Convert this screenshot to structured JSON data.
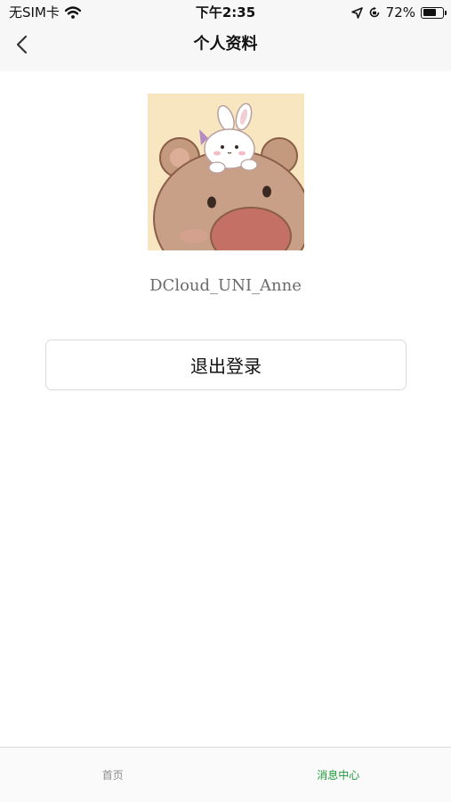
{
  "status_bar": {
    "carrier": "无SIM卡",
    "time": "下午2:35",
    "battery_percent": "72%",
    "battery_level": 0.72,
    "icons": [
      "wifi-icon",
      "location-arrow-icon",
      "orientation-lock-icon",
      "battery-icon"
    ]
  },
  "nav": {
    "title": "个人资料",
    "back_icon": "chevron-left-icon"
  },
  "profile": {
    "avatar_icon": "bear-bunny-avatar",
    "username": "DCloud_UNI_Anne"
  },
  "actions": {
    "logout_label": "退出登录"
  },
  "tabbar": {
    "items": [
      {
        "label": "首页",
        "active": false
      },
      {
        "label": "消息中心",
        "active": true
      }
    ]
  },
  "colors": {
    "active_tab": "#1f9a3a",
    "inactive_tab": "#8c8c8c",
    "nav_background": "#f7f7f7",
    "username": "#6b6b6b"
  }
}
